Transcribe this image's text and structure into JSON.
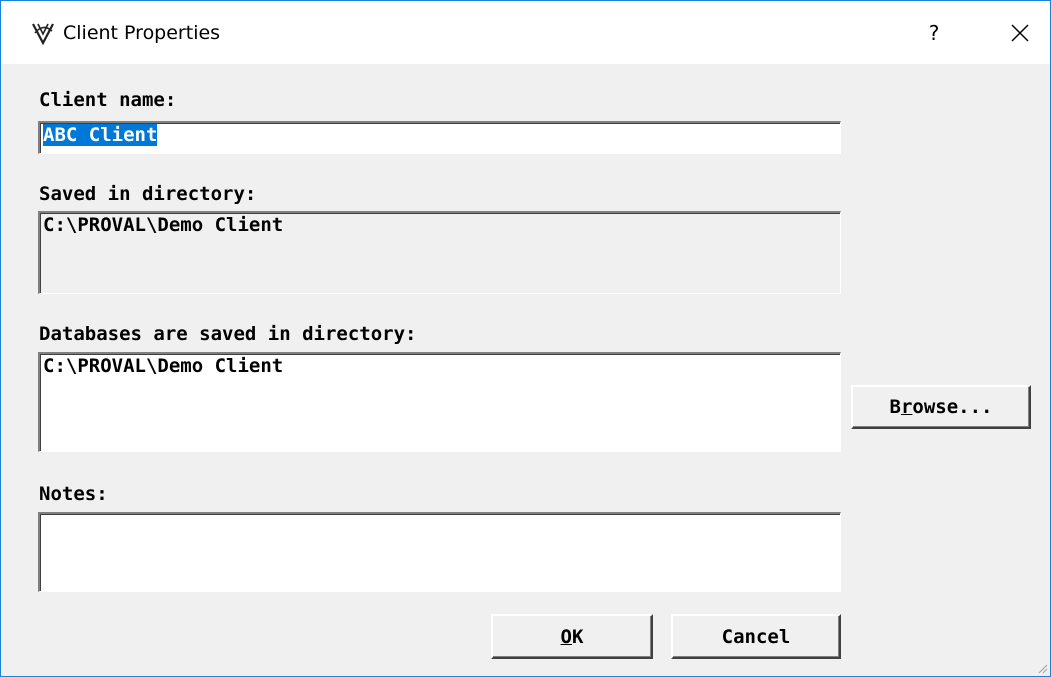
{
  "window": {
    "title": "Client Properties",
    "help_glyph": "?",
    "icon": "app-logo-icon",
    "close_icon": "close-icon"
  },
  "form": {
    "client_name_label": "Client name:",
    "client_name_value": "ABC Client",
    "saved_dir_label": "Saved in directory:",
    "saved_dir_value": "C:\\PROVAL\\Demo Client",
    "db_dir_label": "Databases are saved in directory:",
    "db_dir_value": "C:\\PROVAL\\Demo Client",
    "notes_label": "Notes:",
    "notes_value": ""
  },
  "buttons": {
    "browse_pre": "B",
    "browse_mnemonic": "r",
    "browse_post": "owse...",
    "ok_mnemonic": "O",
    "ok_post": "K",
    "cancel": "Cancel"
  },
  "colors": {
    "accent": "#0078d7",
    "window_border": "#1883d7",
    "dialog_bg": "#f0f0f0"
  }
}
